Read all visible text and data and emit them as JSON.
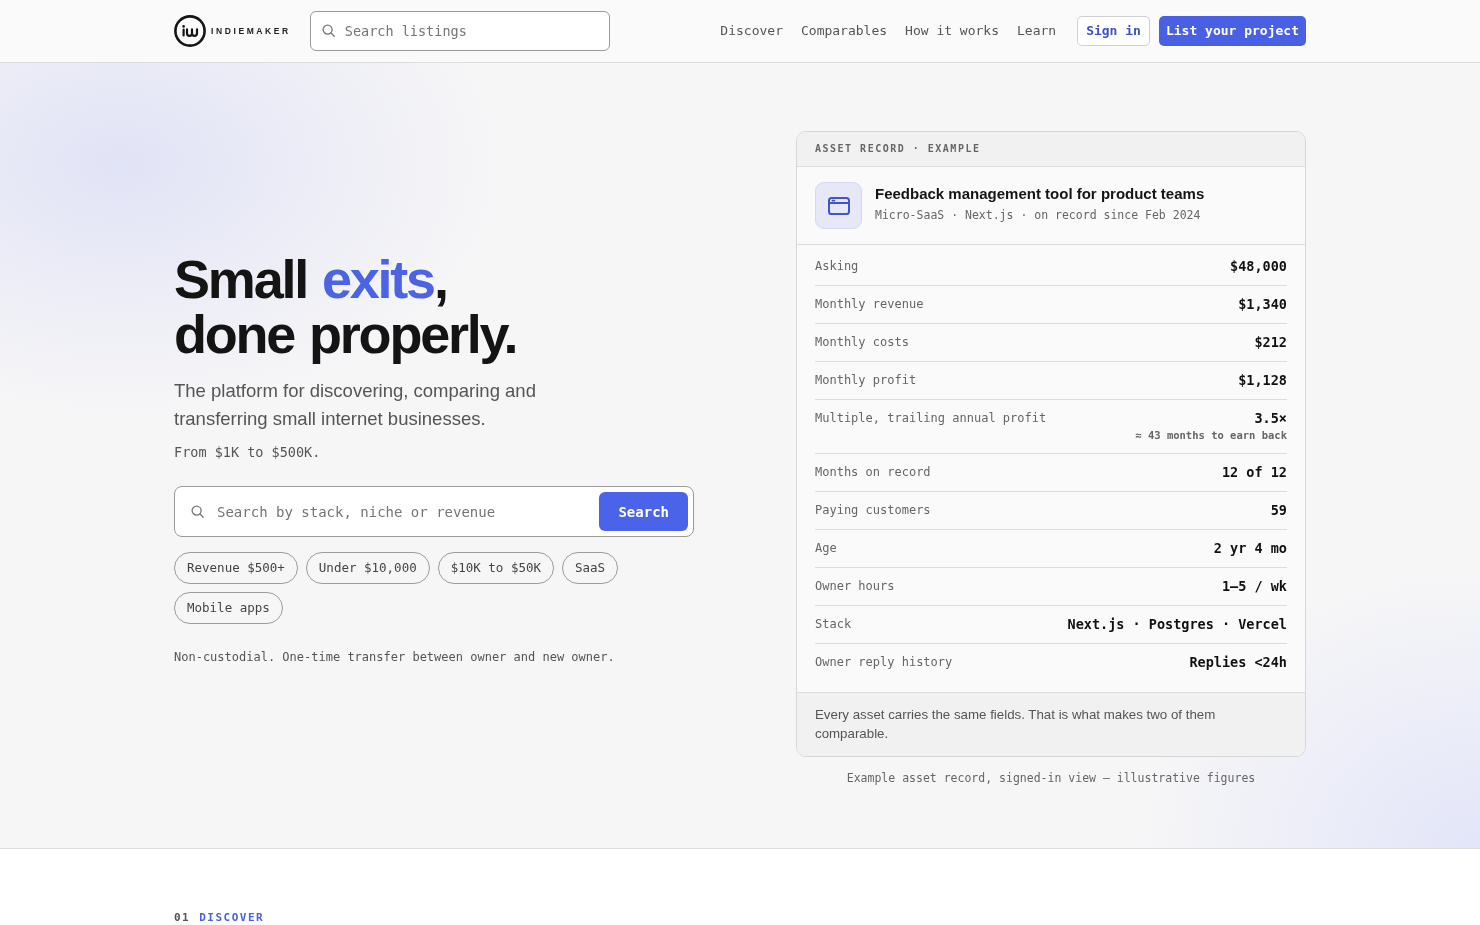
{
  "header": {
    "brand": "INDIEMAKER",
    "search": {
      "placeholder": "Search listings"
    },
    "nav": [
      {
        "label": "Discover"
      },
      {
        "label": "Comparables"
      },
      {
        "label": "How it works"
      },
      {
        "label": "Learn"
      }
    ],
    "sign_in": "Sign in",
    "cta": "List your project"
  },
  "hero": {
    "headline": [
      {
        "text": "Small ",
        "accent": false
      },
      {
        "text": "exits",
        "accent": true
      },
      {
        "text": ", done properly.",
        "accent": false
      }
    ],
    "description": "The platform for discovering, comparing and transferring small internet businesses.",
    "range_note": "From $1K to $500K.",
    "search": {
      "placeholder": "Search by stack, niche or revenue",
      "button": "Search"
    },
    "filters": [
      {
        "label": "Revenue $500+"
      },
      {
        "label": "Under $10,000"
      },
      {
        "label": "$10K to $50K"
      },
      {
        "label": "SaaS"
      },
      {
        "label": "Mobile apps"
      }
    ],
    "disclaimer": "Non-custodial. One-time transfer between owner and new owner."
  },
  "asset_record": {
    "header": "ASSET RECORD · EXAMPLE",
    "title": "Feedback management tool for product teams",
    "meta": "Micro-SaaS · Next.js · on record since Feb 2024",
    "rows": [
      {
        "label": "Asking",
        "value": "$48,000"
      },
      {
        "label": "Monthly revenue",
        "value": "$1,340"
      },
      {
        "label": "Monthly costs",
        "value": "$212"
      },
      {
        "label": "Monthly profit",
        "value": "$1,128"
      },
      {
        "label": "Multiple, trailing annual profit",
        "value": "3.5×",
        "note": "≈ 43 months to earn back"
      },
      {
        "label": "Months on record",
        "value": "12 of 12"
      },
      {
        "label": "Paying customers",
        "value": "59"
      },
      {
        "label": "Age",
        "value": "2 yr 4 mo"
      },
      {
        "label": "Owner hours",
        "value": "1–5 / wk"
      },
      {
        "label": "Stack",
        "value": "Next.js · Postgres · Vercel"
      },
      {
        "label": "Owner reply history",
        "value": "Replies <24h"
      }
    ],
    "footer": "Every asset carries the same fields. That is what makes two of them comparable."
  },
  "record_caption": "Example asset record, signed-in view — illustrative figures",
  "next_section": {
    "number": "01",
    "label": "DISCOVER"
  }
}
